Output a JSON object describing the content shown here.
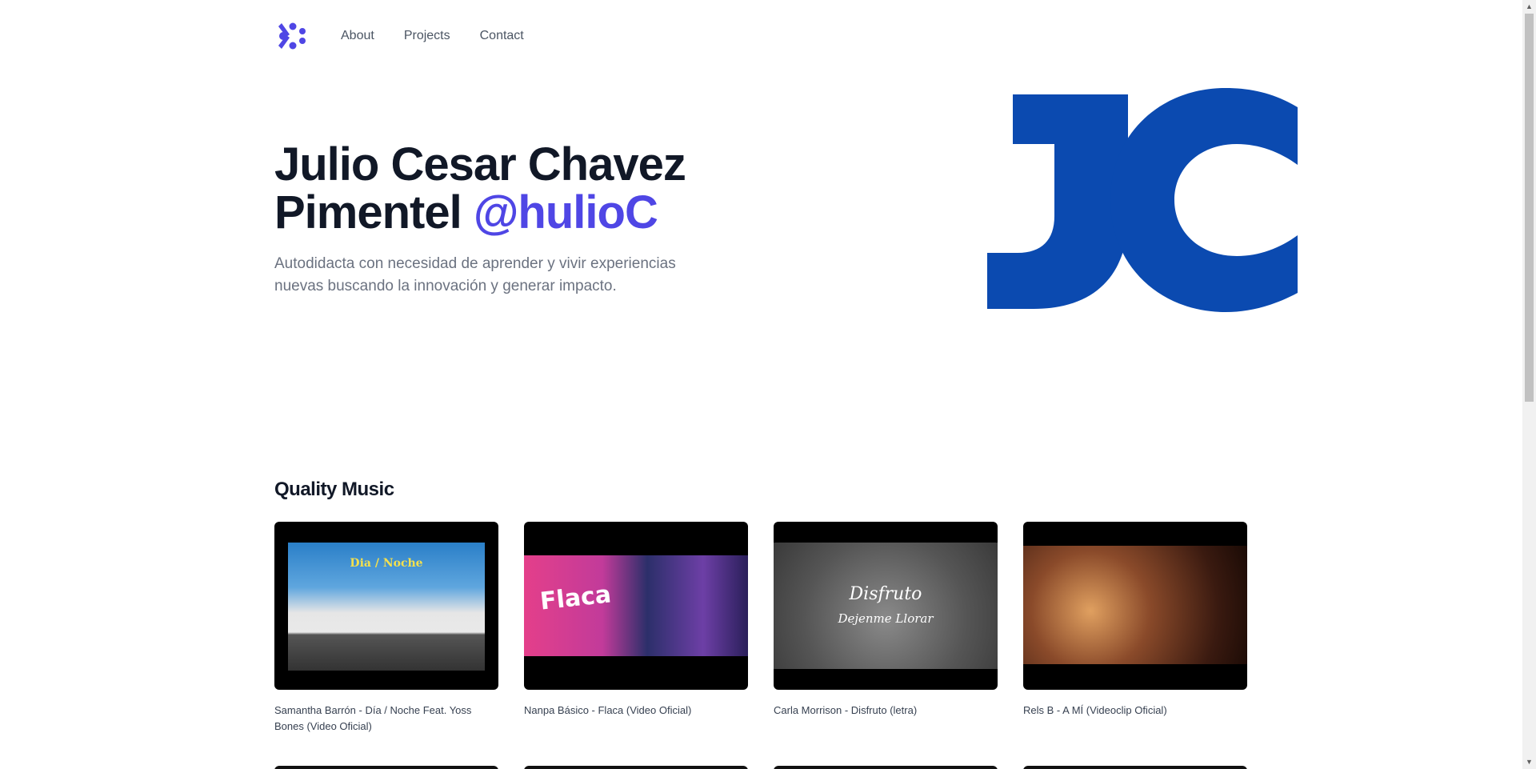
{
  "nav": {
    "logo_icon": "asterisk-dots-logo-icon",
    "links": [
      "About",
      "Projects",
      "Contact"
    ]
  },
  "hero": {
    "title_line1": "Julio Cesar Chavez",
    "title_line2": "Pimentel",
    "handle": "@hulioC",
    "subtitle": "Autodidacta con necesidad de aprender y vivir experiencias nuevas buscando la innovación y generar impacto.",
    "logo_text": "JC"
  },
  "section": {
    "title": "Quality Music",
    "videos": [
      {
        "caption": "Samantha Barrón - Día / Noche Feat. Yoss Bones (Video Oficial)",
        "thumb_text": "Dia / Noche"
      },
      {
        "caption": "Nanpa Básico - Flaca (Video Oficial)",
        "thumb_text": "Flaca"
      },
      {
        "caption": "Carla Morrison - Disfruto (letra)",
        "thumb_text": "Disfruto",
        "thumb_text2": "Dejenme Llorar"
      },
      {
        "caption": "Rels B - A MÍ (Videoclip Oficial)"
      }
    ]
  },
  "colors": {
    "accent": "#4f46e5",
    "logo_blue": "#0b4ab0",
    "text_dark": "#111827",
    "text_muted": "#6b7280"
  }
}
